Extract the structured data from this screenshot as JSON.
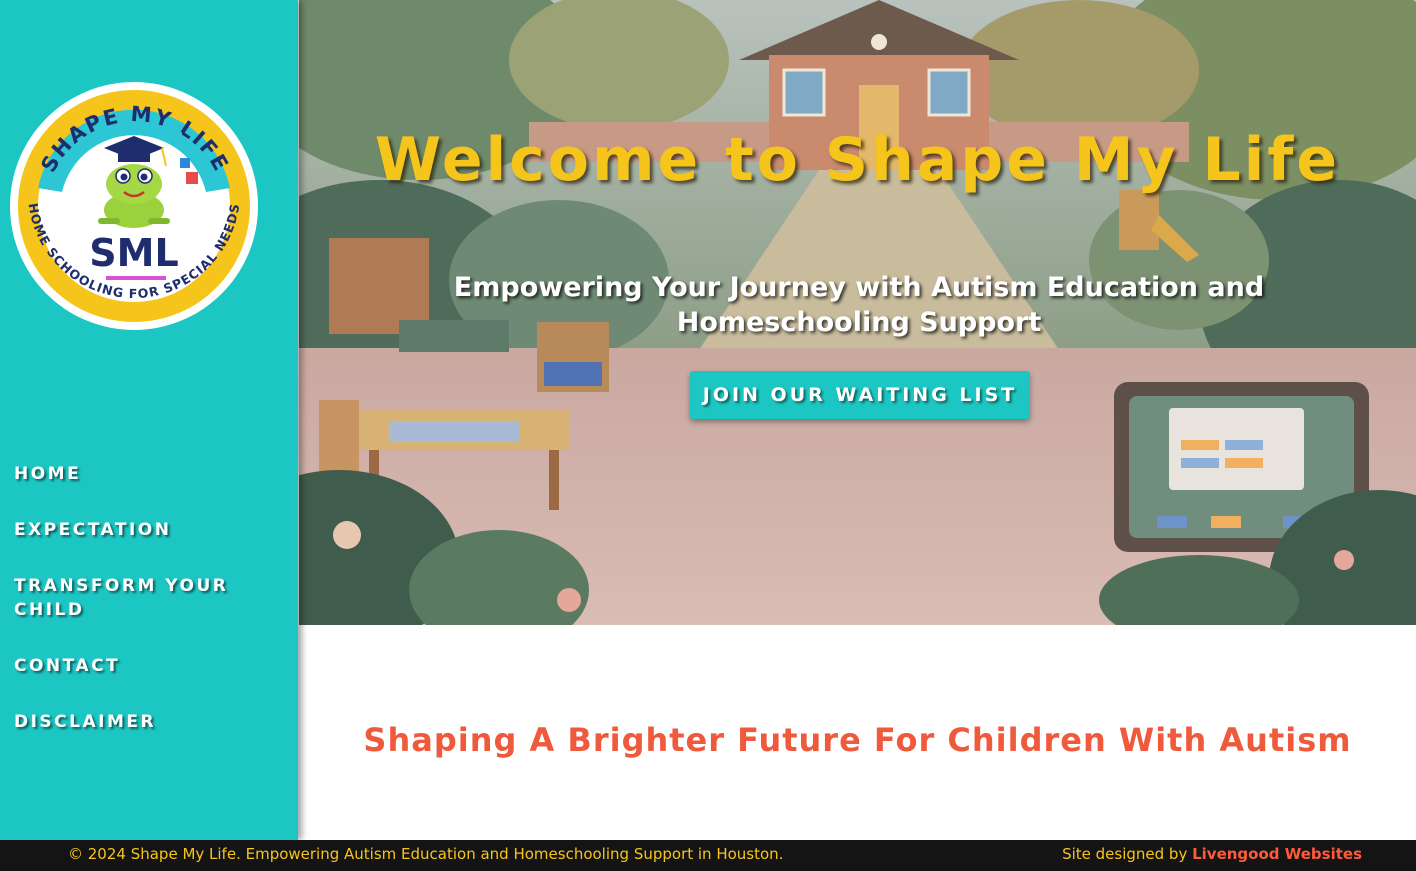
{
  "brand": {
    "logo_text_top": "SHAPE MY LIFE",
    "logo_initials": "SML",
    "logo_text_ring": "HOME SCHOOLING FOR SPECIAL NEEDS"
  },
  "nav": {
    "items": [
      {
        "label": "HOME"
      },
      {
        "label": "EXPECTATION"
      },
      {
        "label": "TRANSFORM YOUR CHILD"
      },
      {
        "label": "CONTACT"
      },
      {
        "label": "DISCLAIMER"
      }
    ]
  },
  "hero": {
    "title": "Welcome to Shape My Life",
    "subtitle": "Empowering Your Journey with Autism Education and Homeschooling Support",
    "cta_label": "JOIN OUR WAITING LIST"
  },
  "main": {
    "tagline": "Shaping A Brighter Future For Children With Autism"
  },
  "footer": {
    "copyright": "© 2024 Shape My Life. Empowering Autism Education and Homeschooling Support in Houston.",
    "credit_prefix": "Site designed by ",
    "credit_link": "Livengood Websites"
  },
  "colors": {
    "sidebar": "#1cc6c2",
    "title_yellow": "#f6c51c",
    "accent_coral": "#f05a3c",
    "footer_bg": "#141414"
  }
}
